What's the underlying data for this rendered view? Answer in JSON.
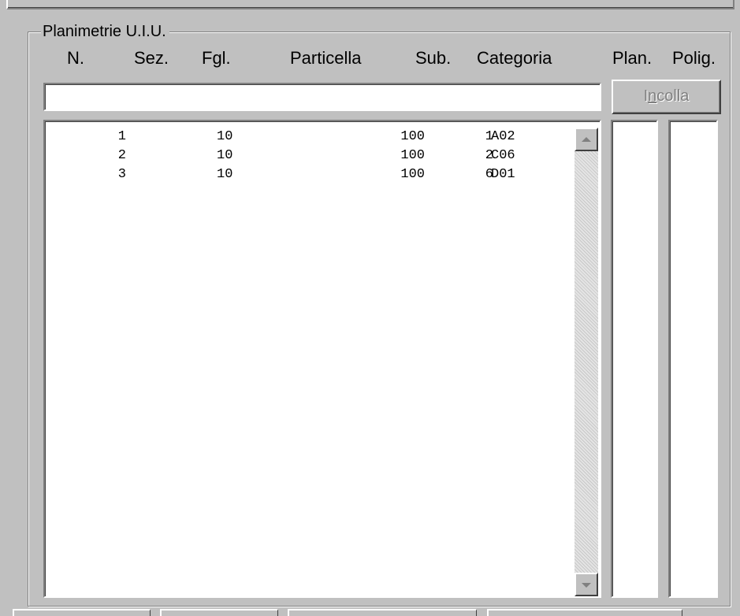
{
  "group": {
    "title": "Planimetrie U.I.U."
  },
  "columns": {
    "n": "N.",
    "sez": "Sez.",
    "fgl": "Fgl.",
    "particella": "Particella",
    "sub": "Sub.",
    "categoria": "Categoria",
    "plan": "Plan.",
    "polig": "Polig."
  },
  "edit": {
    "value": ""
  },
  "paste_button": {
    "label_pre": "I",
    "label_accel": "n",
    "label_post": "colla",
    "enabled": false
  },
  "rows": [
    {
      "n": "1",
      "sez": "",
      "fgl": "10",
      "particella": "100",
      "sub": "1",
      "categoria": "A02"
    },
    {
      "n": "2",
      "sez": "",
      "fgl": "10",
      "particella": "100",
      "sub": "2",
      "categoria": "C06"
    },
    {
      "n": "3",
      "sez": "",
      "fgl": "10",
      "particella": "100",
      "sub": "6",
      "categoria": "D01"
    }
  ],
  "scrollbar": {
    "up_icon": "scroll-up-arrow",
    "down_icon": "scroll-down-arrow"
  },
  "colors": {
    "face": "#c0c0c0",
    "disabled_text": "#808080",
    "window": "#ffffff"
  }
}
